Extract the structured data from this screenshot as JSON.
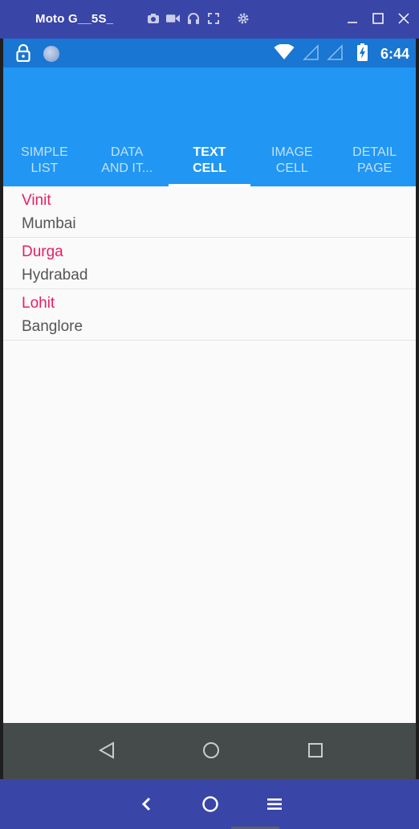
{
  "window": {
    "title": "Moto G__5S_",
    "tools": [
      "camera-icon",
      "video-icon",
      "headphones-icon",
      "fullscreen-icon",
      "settings-icon"
    ],
    "controls": [
      "minimize-icon",
      "maximize-icon",
      "close-icon"
    ]
  },
  "status_bar": {
    "time": "6:44",
    "icons": [
      "lock-icon",
      "notification-dot-icon",
      "wifi-icon",
      "signal-icon",
      "signal-icon",
      "battery-charging-icon"
    ]
  },
  "tabs": [
    {
      "label_line1": "SIMPLE",
      "label_line2": "LIST",
      "active": false
    },
    {
      "label_line1": "DATA",
      "label_line2": "AND IT...",
      "active": false
    },
    {
      "label_line1": "TEXT",
      "label_line2": "CELL",
      "active": true
    },
    {
      "label_line1": "IMAGE",
      "label_line2": "CELL",
      "active": false
    },
    {
      "label_line1": "DETAIL",
      "label_line2": "PAGE",
      "active": false
    }
  ],
  "list": [
    {
      "name": "Vinit",
      "city": "Mumbai"
    },
    {
      "name": "Durga",
      "city": "Hydrabad"
    },
    {
      "name": "Lohit",
      "city": "Banglore"
    }
  ],
  "nav_bar": [
    "back-triangle-icon",
    "home-circle-icon",
    "recents-square-icon"
  ],
  "host_bar": [
    "chevron-left-icon",
    "home-circle-icon",
    "menu-icon"
  ],
  "colors": {
    "window_bar": "#3a45a8",
    "status_bar": "#1976d2",
    "app_bar": "#2196f3",
    "name_text": "#e91e63",
    "nav_bar": "#454b4b"
  }
}
